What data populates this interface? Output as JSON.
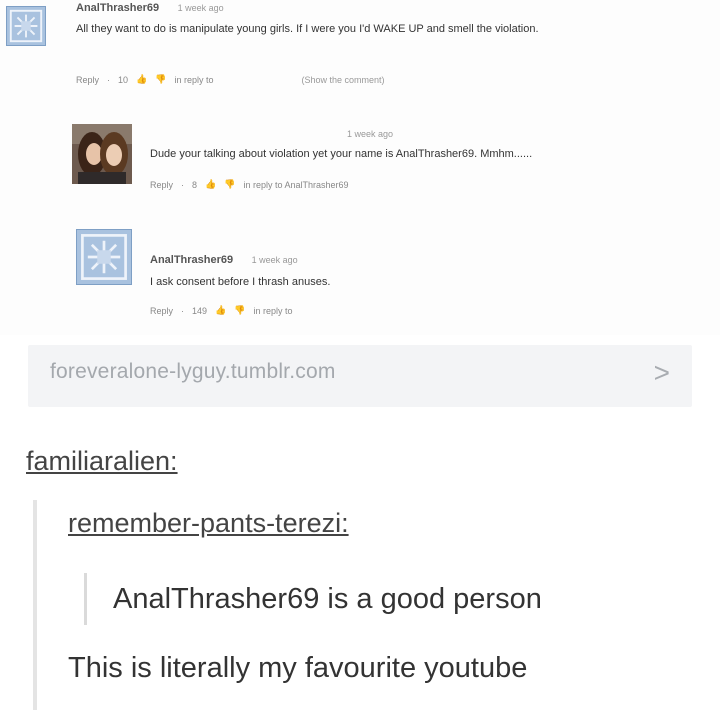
{
  "comments": [
    {
      "user": "AnalThrasher69",
      "time": "1 week ago",
      "text": "All they want to do is manipulate young girls. If I were you I'd WAKE UP and smell the violation.",
      "reply_label": "Reply",
      "likes": "10",
      "reply_info": "in reply to",
      "show_comment": "(Show the comment)"
    },
    {
      "user": "",
      "time": "1 week ago",
      "text": "Dude your talking about violation yet your name is AnalThrasher69. Mmhm......",
      "reply_label": "Reply",
      "likes": "8",
      "reply_info": "in reply to AnalThrasher69"
    },
    {
      "user": "AnalThrasher69",
      "time": "1 week ago",
      "text": "I ask consent before I thrash anuses.",
      "reply_label": "Reply",
      "likes": "149",
      "reply_info": "in reply to"
    }
  ],
  "link_preview": {
    "url": "foreveralone-lyguy.tumblr.com",
    "chevron": ">"
  },
  "tumblr": {
    "reblogger": "familiaralien:",
    "quoted_reblogger": "remember-pants-terezi:",
    "quoted_text": "AnalThrasher69 is a good person",
    "reply_text": "This is literally my favourite youtube"
  }
}
